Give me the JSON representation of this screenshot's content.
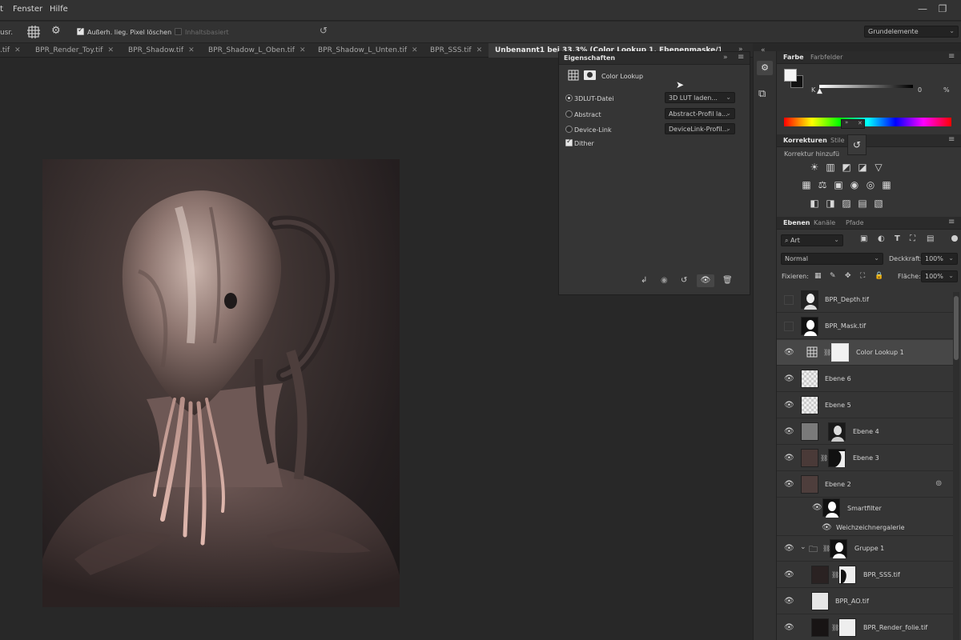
{
  "menu": {
    "items": [
      "Fenster",
      "Hilfe"
    ],
    "cut_left": "t",
    "win_minimize": "—",
    "win_restore": "❐"
  },
  "options_bar": {
    "cut_label": "usr.",
    "checkbox_delete_label": "Außerh. lieg. Pixel löschen",
    "checkbox_content_label": "Inhaltsbasiert",
    "workspace": "Grundelemente"
  },
  "tabs": [
    {
      "label": ".tif",
      "active": false
    },
    {
      "label": "BPR_Render_Toy.tif",
      "active": false
    },
    {
      "label": "BPR_Shadow.tif",
      "active": false
    },
    {
      "label": "BPR_Shadow_L_Oben.tif",
      "active": false
    },
    {
      "label": "BPR_Shadow_L_Unten.tif",
      "active": false
    },
    {
      "label": "BPR_SSS.tif",
      "active": false
    },
    {
      "label": "Unbenannt1 bei 33,3% (Color Lookup 1, Ebenenmaske/16) *",
      "active": true
    }
  ],
  "properties": {
    "title": "Eigenschaften",
    "adjustment": "Color Lookup",
    "options": [
      {
        "label": "3DLUT-Datei",
        "value": "3D LUT laden...",
        "selected": true
      },
      {
        "label": "Abstract",
        "value": "Abstract-Profil la...",
        "selected": false
      },
      {
        "label": "Device-Link",
        "value": "DeviceLink-Profil...",
        "selected": false
      }
    ],
    "dither_label": "Dither",
    "dither_checked": true
  },
  "color_panel": {
    "tabs": [
      "Farbe",
      "Farbfelder"
    ],
    "k_label": "K",
    "k_value": "0",
    "k_unit": "%"
  },
  "adjustments_panel": {
    "tabs": [
      "Korrekturen",
      "Stile"
    ],
    "hint": "Korrektur hinzufü",
    "icons_row1": [
      "☀",
      "▥",
      "◩",
      "◪",
      "▽"
    ],
    "icons_row2": [
      "▦",
      "⚖",
      "▣",
      "◉",
      "◎",
      "▦"
    ],
    "icons_row3": [
      "◧",
      "◨",
      "▨",
      "▤",
      "▧"
    ]
  },
  "layers_panel": {
    "tabs": [
      "Ebenen",
      "Kanäle",
      "Pfade"
    ],
    "filter_label": "Art",
    "blend_mode": "Normal",
    "opacity_label": "Deckkraft:",
    "opacity_value": "100%",
    "lock_label": "Fixieren:",
    "fill_label": "Fläche:",
    "fill_value": "100%",
    "layers": [
      {
        "name": "BPR_Depth.tif",
        "visible": false
      },
      {
        "name": "BPR_Mask.tif",
        "visible": false
      },
      {
        "name": "Color Lookup 1",
        "visible": true,
        "selected": true
      },
      {
        "name": "Ebene 6",
        "visible": true
      },
      {
        "name": "Ebene 5",
        "visible": true
      },
      {
        "name": "Ebene 4",
        "visible": true
      },
      {
        "name": "Ebene 3",
        "visible": true
      },
      {
        "name": "Ebene 2",
        "visible": true
      },
      {
        "name": "Smartfilter",
        "visible": true
      },
      {
        "name": "Weichzeichnergalerie",
        "visible": true
      },
      {
        "name": "Gruppe 1",
        "visible": true
      },
      {
        "name": "BPR_SSS.tif",
        "visible": true
      },
      {
        "name": "BPR_AO.tif",
        "visible": true
      },
      {
        "name": "BPR_Render_folie.tif",
        "visible": true
      }
    ]
  },
  "colors": {
    "accent": "#4a90d9",
    "panel": "#353535",
    "canvas": "#282828"
  }
}
